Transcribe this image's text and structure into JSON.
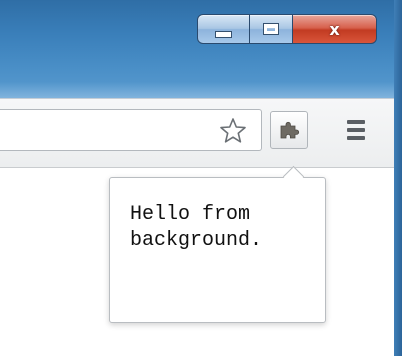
{
  "window_controls": {
    "minimize_icon": "minimize-icon",
    "maximize_icon": "maximize-icon",
    "close_glyph": "x",
    "close_color": "#c7432a"
  },
  "toolbar": {
    "bookmark_icon": "star-icon",
    "extension_icon": "puzzle-piece-icon",
    "menu_icon": "hamburger-menu-icon"
  },
  "popup": {
    "message": "Hello from\nbackground."
  },
  "colors": {
    "titlebar": "#3a7fba",
    "toolbar": "#eef0f1",
    "popup_border": "#b9bdc1"
  }
}
